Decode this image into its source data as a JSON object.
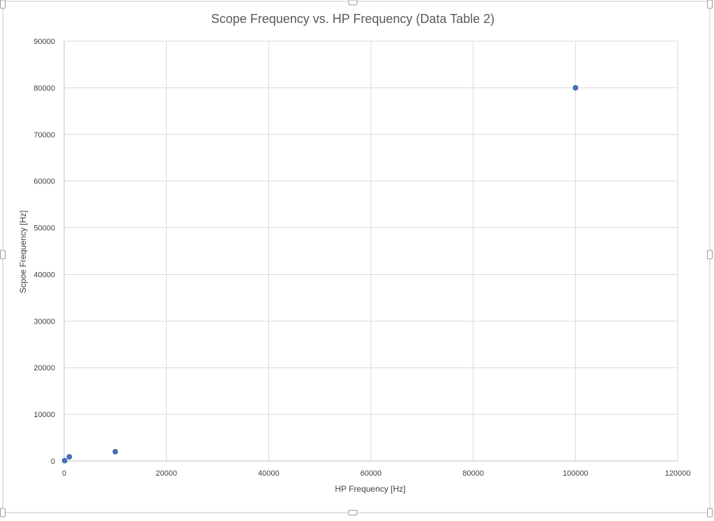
{
  "chart_data": {
    "type": "scatter",
    "title": "Scope Frequency vs. HP Frequency (Data Table 2)",
    "xlabel": "HP Frequency [Hz]",
    "ylabel": "Scpoe Frequency [Hz]",
    "xlim": [
      0,
      120000
    ],
    "ylim": [
      0,
      90000
    ],
    "x_ticks": [
      "0",
      "20000",
      "40000",
      "60000",
      "80000",
      "100000",
      "120000"
    ],
    "y_ticks": [
      "0",
      "10000",
      "20000",
      "30000",
      "40000",
      "50000",
      "60000",
      "70000",
      "80000",
      "90000"
    ],
    "grid": true,
    "legend": "none",
    "series": [
      {
        "x": [
          100,
          1000,
          10000,
          100000
        ],
        "y": [
          100,
          900,
          2000,
          80000
        ]
      }
    ],
    "colors": {
      "marker": "#4472c4",
      "marker_edge": "#2f528f",
      "grid": "#d9d9d9"
    }
  }
}
